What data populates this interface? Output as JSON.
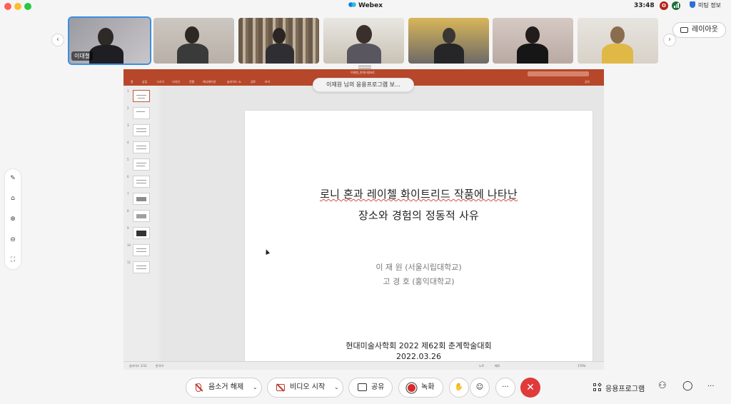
{
  "window": {
    "app_title": "Webex",
    "clock": "33:48",
    "rec_badge": "O",
    "meeting_info_label": "미팅 정보"
  },
  "participants": {
    "active_name": "이대철",
    "layout_button": "레이아웃",
    "prev_icon": "chevron-left-icon",
    "next_icon": "chevron-right-icon"
  },
  "share": {
    "notice": "이재원 님의 응용프로그램 보…",
    "ppt_doc_title": "이재원_현대사발표1",
    "ppt_tabs": [
      "홈",
      "삽입",
      "그리기",
      "디자인",
      "전환",
      "애니메이션",
      "슬라이드 쇼",
      "검토",
      "보기"
    ],
    "ppt_share": "공유",
    "thumbnails": [
      "1",
      "2",
      "3",
      "4",
      "5",
      "6",
      "7",
      "8",
      "9",
      "10",
      "11"
    ],
    "status_left": "슬라이드 1/11",
    "status_lang": "한국어",
    "status_notes": "노트",
    "status_comments": "메모",
    "zoom": "170%"
  },
  "slide": {
    "title_line1": "로니 혼과 레이첼 화이트리드 작품에 나타난",
    "title_line2": "장소와 경험의 정동적 사유",
    "author1": "이 재 원 (서울시립대학교)",
    "author2": "고 경 호 (홍익대학교)",
    "event": "현대미술사학회 2022 제62회 춘계학술대회",
    "date": "2022.03.26"
  },
  "controls": {
    "unmute": "음소거 해제",
    "start_video": "비디오 시작",
    "share": "공유",
    "record": "녹화",
    "more": "···",
    "leave": "✕",
    "apps": "응용프로그램",
    "overflow": "···"
  },
  "colors": {
    "ppt_accent": "#b7472a",
    "leave_red": "#e03a3a",
    "active_outline": "#3b8fe0"
  }
}
